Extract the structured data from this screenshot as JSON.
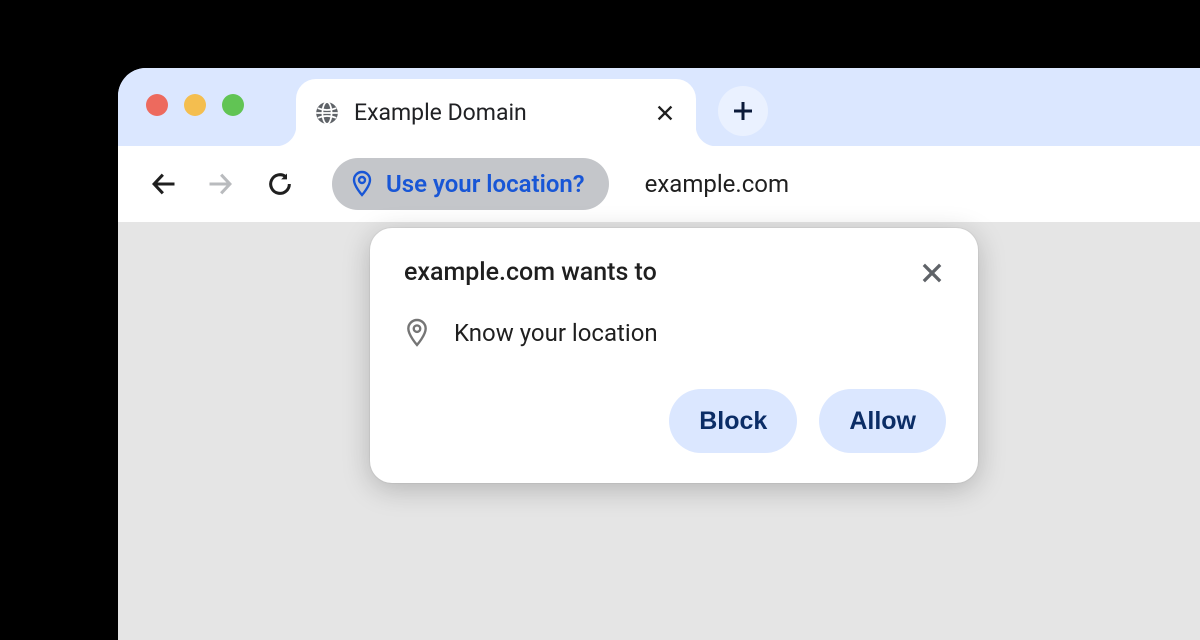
{
  "tab": {
    "title": "Example Domain",
    "favicon": "globe-icon"
  },
  "toolbar": {
    "url": "example.com",
    "location_chip": "Use your location?"
  },
  "popup": {
    "title": "example.com wants to",
    "permission_label": "Know your location",
    "block_label": "Block",
    "allow_label": "Allow"
  },
  "colors": {
    "tabstrip_bg": "#dbe7ff",
    "accent_blue": "#1856d6",
    "pill_bg": "#dbe7ff",
    "pill_text": "#0b2d66"
  }
}
